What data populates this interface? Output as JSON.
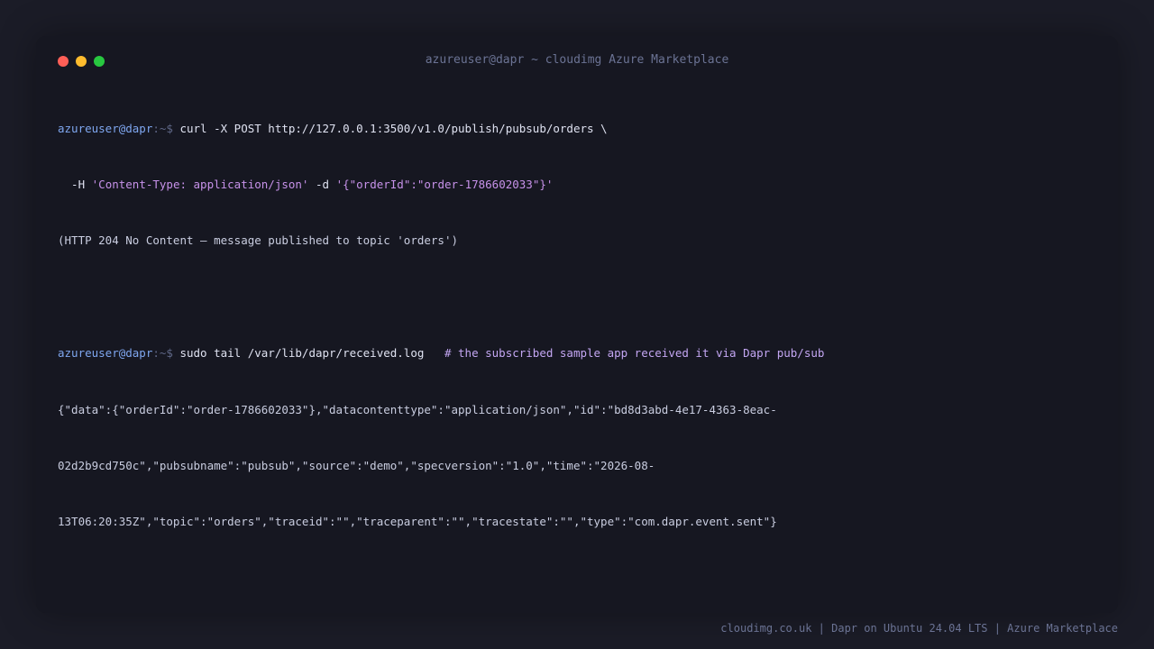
{
  "window": {
    "title": "azureuser@dapr ~ cloudimg Azure Marketplace"
  },
  "terminal": {
    "prompt_user": "azureuser@dapr",
    "prompt_sep": ":~$",
    "cmd1_line1": " curl -X POST http://127.0.0.1:3500/v1.0/publish/pubsub/orders \\",
    "cmd1_line2_pre": "  -H ",
    "cmd1_line2_str1": "'Content-Type: application/json'",
    "cmd1_line2_mid": " -d ",
    "cmd1_line2_str2": "'{\"orderId\":\"order-1786602033\"}'",
    "out1": "(HTTP 204 No Content — message published to topic 'orders')",
    "cmd2": " sudo tail /var/lib/dapr/received.log   ",
    "cmd2_comment": "# the subscribed sample app received it via Dapr pub/sub",
    "out2_line1": "{\"data\":{\"orderId\":\"order-1786602033\"},\"datacontenttype\":\"application/json\",\"id\":\"bd8d3abd-4e17-4363-8eac-",
    "out2_line2": "02d2b9cd750c\",\"pubsubname\":\"pubsub\",\"source\":\"demo\",\"specversion\":\"1.0\",\"time\":\"2026-08-",
    "out2_line3": "13T06:20:35Z\",\"topic\":\"orders\",\"traceid\":\"\",\"traceparent\":\"\",\"tracestate\":\"\",\"type\":\"com.dapr.event.sent\"}"
  },
  "footer": {
    "text": "cloudimg.co.uk | Dapr on Ubuntu 24.04 LTS | Azure Marketplace"
  }
}
